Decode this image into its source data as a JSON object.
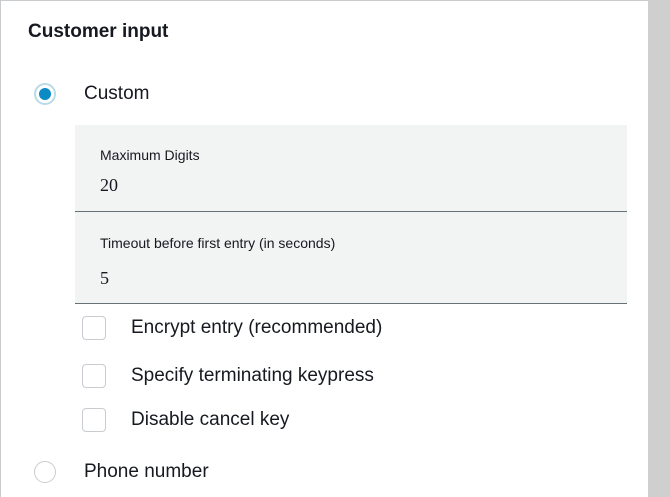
{
  "section": {
    "title": "Customer input"
  },
  "options": {
    "custom": {
      "label": "Custom",
      "selected": true
    },
    "phone": {
      "label": "Phone number",
      "selected": false
    }
  },
  "fields": {
    "max_digits": {
      "label": "Maximum Digits",
      "value": "20"
    },
    "timeout": {
      "label": "Timeout before first entry (in seconds)",
      "value": "5"
    }
  },
  "checkboxes": [
    {
      "label": "Encrypt entry (recommended)",
      "checked": false
    },
    {
      "label": "Specify terminating keypress",
      "checked": false
    },
    {
      "label": "Disable cancel key",
      "checked": false
    }
  ],
  "icons": {
    "radio_selected": "radio-selected-icon",
    "radio_unselected": "radio-unselected-icon",
    "checkbox": "checkbox-empty-icon"
  },
  "colors": {
    "accent": "#0a8bc4",
    "field_background": "#f2f3f3",
    "scrollbar": "#cfcfcf"
  }
}
